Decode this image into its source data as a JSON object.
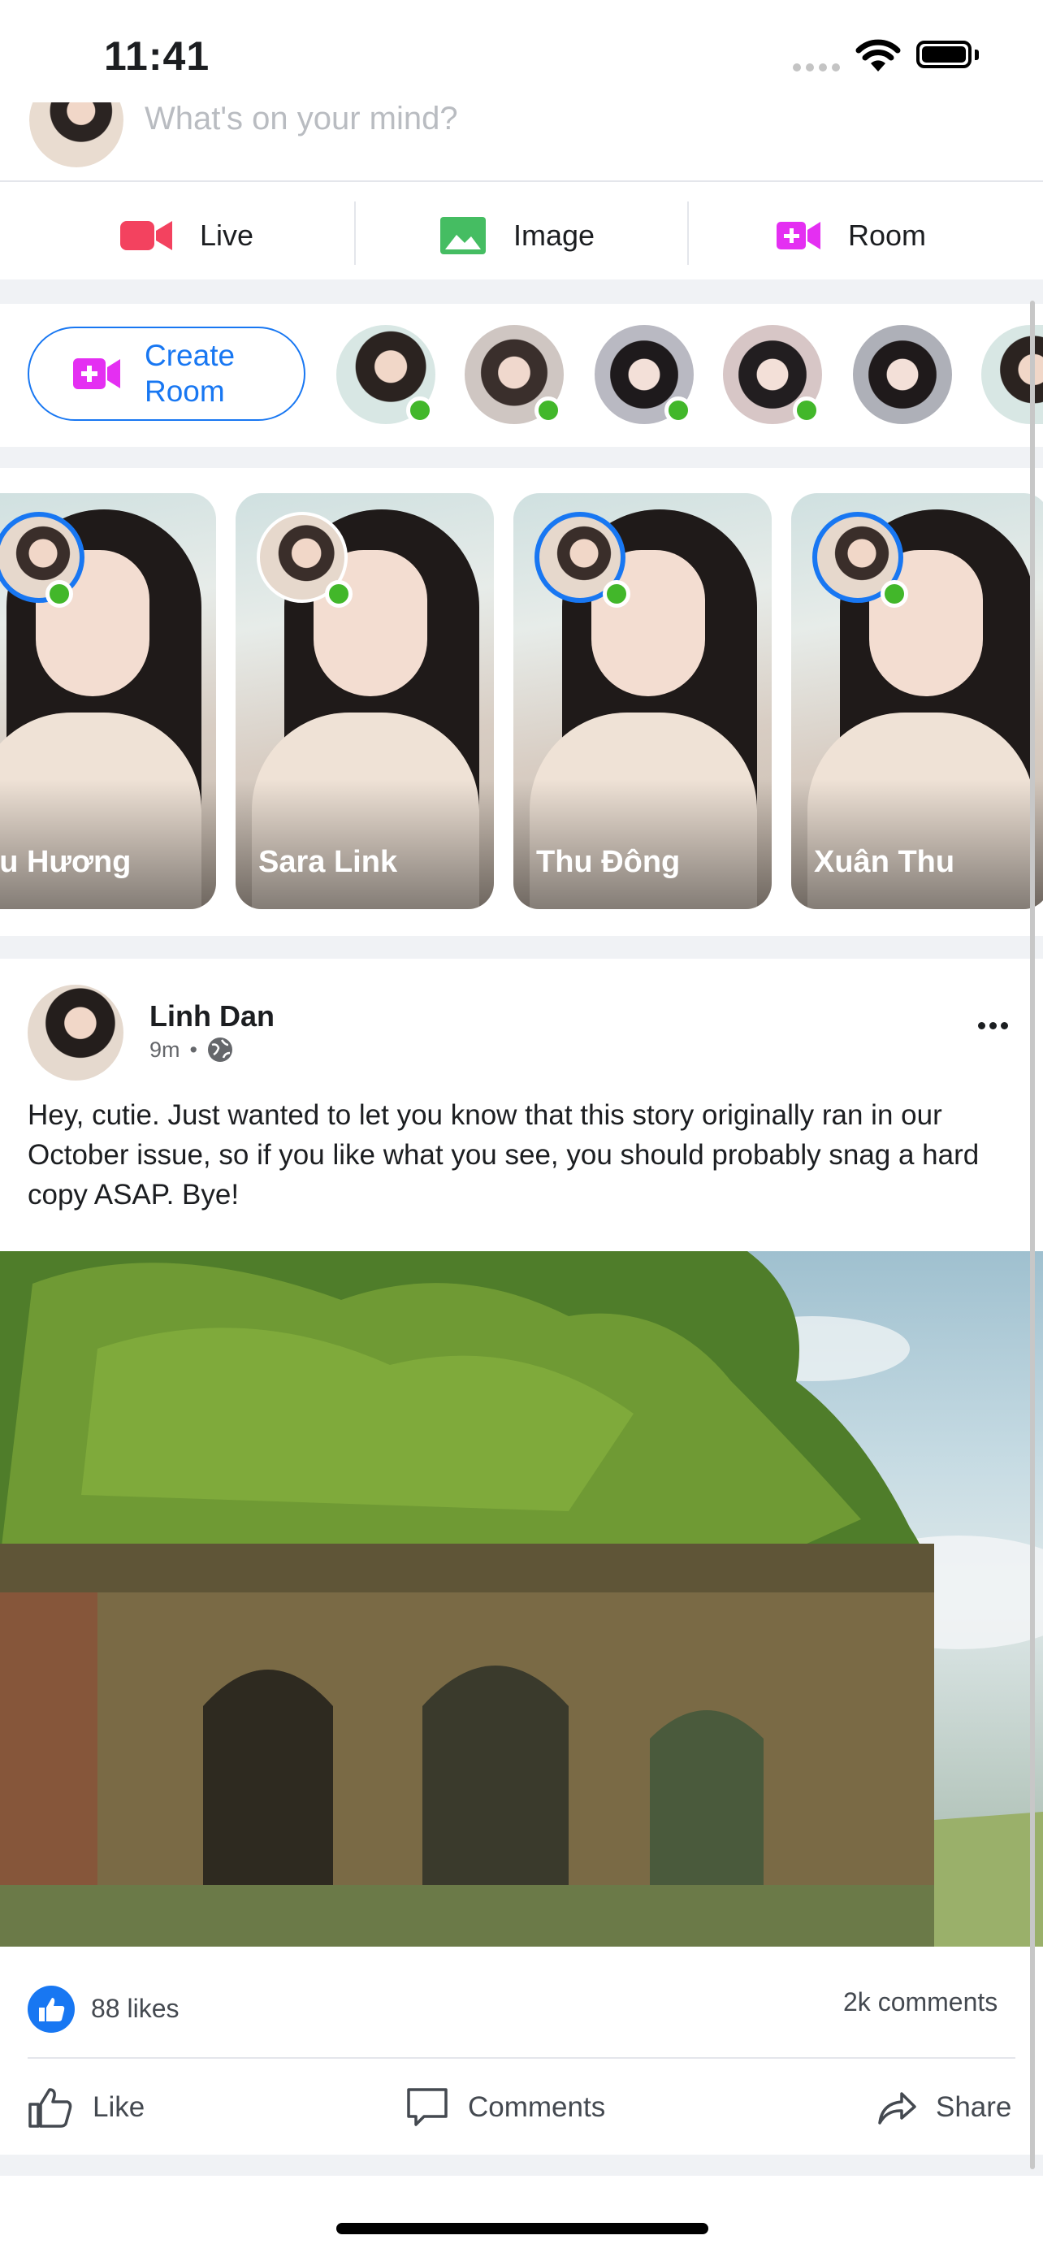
{
  "status_bar": {
    "time": "11:41"
  },
  "composer": {
    "placeholder": "What's on your mind?"
  },
  "actions": [
    {
      "label": "Live",
      "icon": "video-camera-icon",
      "color": "#f3425f"
    },
    {
      "label": "Image",
      "icon": "image-icon",
      "color": "#45bd62"
    },
    {
      "label": "Room",
      "icon": "video-plus-icon",
      "color": "#e42ff2"
    }
  ],
  "rooms": {
    "create_label": "Create Room"
  },
  "stories": [
    {
      "name": "Thu Hương",
      "shown_partial": "hu Hương"
    },
    {
      "name": "Sara Link"
    },
    {
      "name": "Thu Đông"
    },
    {
      "name": "Xuân Thu"
    }
  ],
  "post": {
    "author": "Linh Dan",
    "time": "9m",
    "text": "Hey, cutie. Just wanted to let you know that this story originally ran in our October issue, so if you like what you see, you should probably snag a hard copy ASAP. Bye!",
    "likes": "88 likes",
    "comments": "2k comments",
    "buttons": {
      "like": "Like",
      "comments": "Comments",
      "share": "Share"
    }
  },
  "colors": {
    "accent": "#1877f2",
    "online": "#42b72a",
    "background_band": "#f0f2f5"
  }
}
